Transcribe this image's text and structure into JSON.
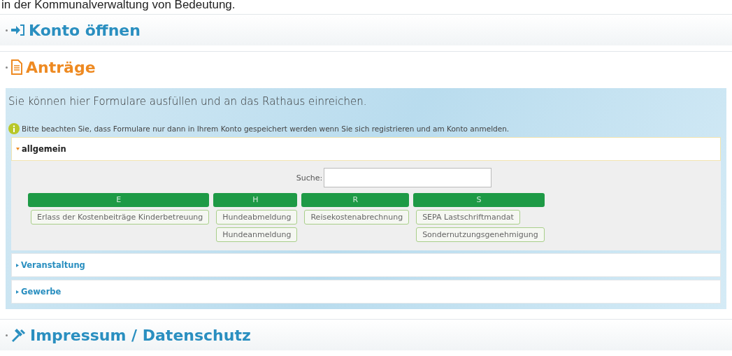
{
  "top_text": "in der Kommunalverwaltung von Bedeutung.",
  "sections": [
    {
      "title": "Konto öffnen",
      "kind": "login",
      "expanded": false
    },
    {
      "title": "Anträge",
      "kind": "form",
      "expanded": true
    }
  ],
  "forms_panel": {
    "intro": "Sie können hier Formulare ausfüllen und an das Rathaus einreichen.",
    "notice": "Bitte beachten Sie, dass Formulare nur dann in Ihrem Konto gespeichert werden wenn Sie sich registrieren und am Konto anmelden.",
    "categories": [
      {
        "title": "allgemein",
        "expanded": true,
        "search_label": "Suche:",
        "groups": [
          {
            "letter": "E",
            "forms": [
              "Erlass der Kostenbeiträge Kinderbetreuung"
            ]
          },
          {
            "letter": "H",
            "forms": [
              "Hundeabmeldung",
              "Hundeanmeldung"
            ]
          },
          {
            "letter": "R",
            "forms": [
              "Reisekostenabrechnung"
            ]
          },
          {
            "letter": "S",
            "forms": [
              "SEPA Lastschriftmandat",
              "Sondernutzungsgenehmigung"
            ]
          }
        ]
      },
      {
        "title": "Veranstaltung",
        "expanded": false
      },
      {
        "title": "Gewerbe",
        "expanded": false
      }
    ]
  },
  "footer_section": {
    "title": "Impressum / Datenschutz",
    "kind": "gavel",
    "expanded": false
  }
}
